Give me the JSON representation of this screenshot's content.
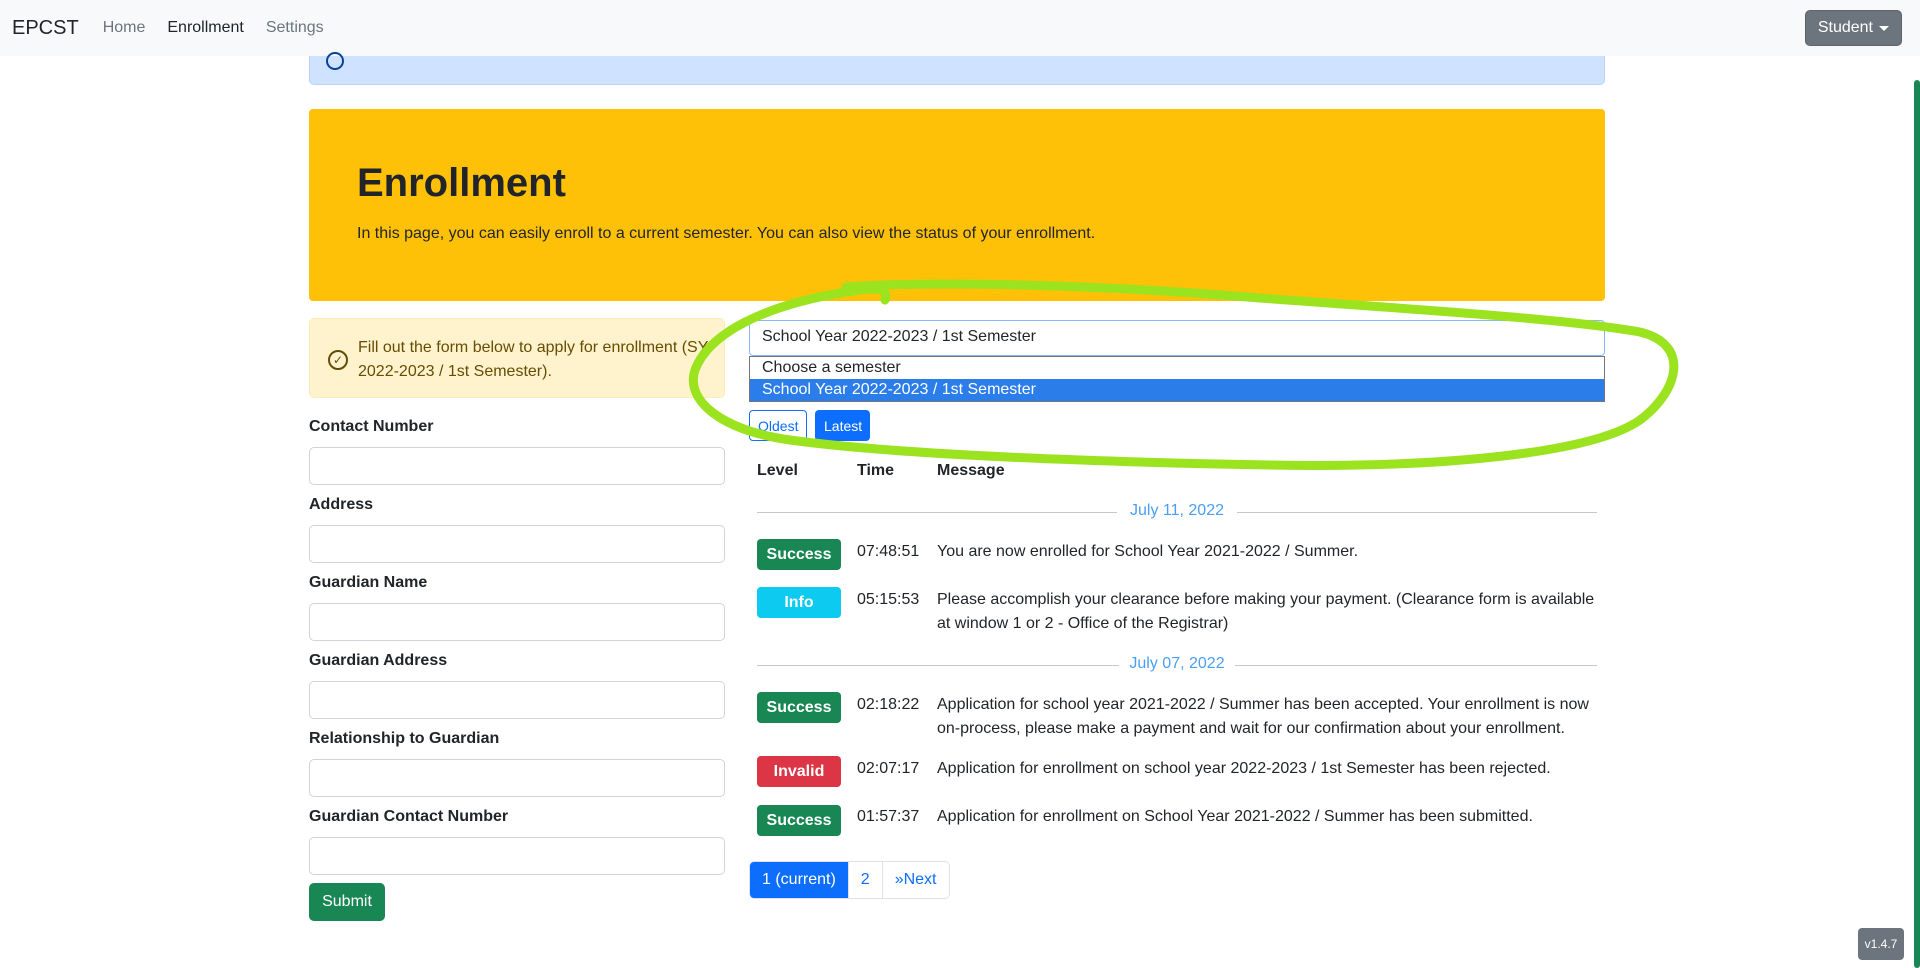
{
  "navbar": {
    "brand": "EPCST",
    "links": [
      "Home",
      "Enrollment",
      "Settings"
    ],
    "user_menu": "Student"
  },
  "hero": {
    "title": "Enrollment",
    "subtitle": "In this page, you can easily enroll to a current semester. You can also view the status of your enrollment."
  },
  "form": {
    "notice": "Fill out the form below to apply for enrollment (SY 2022-2023 / 1st Semester).",
    "fields": [
      {
        "label": "Contact Number",
        "value": ""
      },
      {
        "label": "Address",
        "value": ""
      },
      {
        "label": "Guardian Name",
        "value": ""
      },
      {
        "label": "Guardian Address",
        "value": ""
      },
      {
        "label": "Relationship to Guardian",
        "value": ""
      },
      {
        "label": "Guardian Contact Number",
        "value": ""
      }
    ],
    "submit_label": "Submit"
  },
  "semester_select": {
    "selected": "School Year 2022-2023 / 1st Semester",
    "options": [
      "Choose a semester",
      "School Year 2022-2023 / 1st Semester"
    ]
  },
  "sort": {
    "oldest_label": "Oldest",
    "latest_label": "Latest"
  },
  "log_table": {
    "headers": [
      "Level",
      "Time",
      "Message"
    ],
    "groups": [
      {
        "date": "July 11, 2022",
        "entries": [
          {
            "level": "Success",
            "time": "07:48:51",
            "message": "You are now enrolled for School Year 2021-2022 / Summer."
          },
          {
            "level": "Info",
            "time": "05:15:53",
            "message": "Please accomplish your clearance before making your payment. (Clearance form is available at window 1 or 2 - Office of the Registrar)"
          }
        ]
      },
      {
        "date": "July 07, 2022",
        "entries": [
          {
            "level": "Success",
            "time": "02:18:22",
            "message": "Application for school year 2021-2022 / Summer has been accepted. Your enrollment is now on-process, please make a payment and wait for our confirmation about your enrollment."
          },
          {
            "level": "Invalid",
            "time": "02:07:17",
            "message": "Application for enrollment on school year 2022-2023 / 1st Semester has been rejected."
          },
          {
            "level": "Success",
            "time": "01:57:37",
            "message": "Application for enrollment on School Year 2021-2022 / Summer has been submitted."
          }
        ]
      }
    ]
  },
  "pagination": {
    "current": "1 (current)",
    "page2": "2",
    "next": "»Next"
  },
  "version": "v1.4.7",
  "colors": {
    "hero": "#ffc107",
    "success": "#198754",
    "info": "#0dcaf0",
    "invalid": "#dc3545",
    "primary": "#0d6efd",
    "annotation": "#9be21f"
  }
}
